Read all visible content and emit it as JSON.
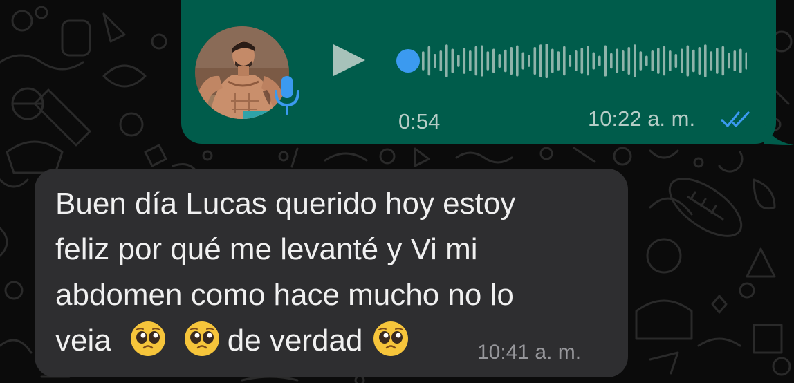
{
  "voice_message": {
    "duration": "0:54",
    "time": "10:22 a. m.",
    "status": "read",
    "waveform_levels": [
      0.55,
      0.85,
      0.4,
      0.6,
      0.95,
      0.7,
      0.35,
      0.75,
      0.6,
      0.85,
      0.9,
      0.55,
      0.7,
      0.4,
      0.65,
      0.8,
      0.9,
      0.5,
      0.35,
      0.8,
      0.95,
      1.0,
      0.7,
      0.55,
      0.85,
      0.35,
      0.6,
      0.75,
      0.85,
      0.5,
      0.3,
      0.9,
      0.45,
      0.7,
      0.6,
      0.8,
      0.95,
      0.55,
      0.3,
      0.6,
      0.75,
      0.85,
      0.6,
      0.4,
      0.7,
      0.9,
      0.65,
      0.8,
      0.95,
      0.55,
      0.75,
      0.85,
      0.45,
      0.6,
      0.7,
      0.5
    ],
    "progress": 0
  },
  "text_message": {
    "line_1": "Buen día Lucas querido hoy estoy",
    "line_2": "feliz por qué me levanté y Vi mi",
    "line_3": "abdomen como hace mucho no lo",
    "line_4_start": "veia",
    "line_4_end": "de verdad",
    "emoji": "pleading-face",
    "time": "10:41 a. m."
  },
  "colors": {
    "outgoing_bubble": "#005c4b",
    "incoming_bubble": "#2e2e30",
    "accent_blue": "#3b9af0",
    "background": "#0b0b0b"
  }
}
